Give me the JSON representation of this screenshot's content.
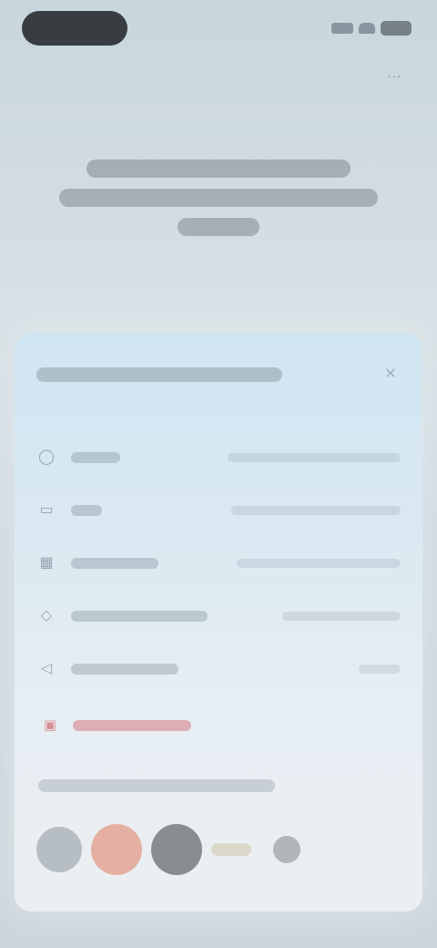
{
  "status_bar": {
    "icons": [
      "signal-icon",
      "wifi-icon",
      "battery-icon"
    ]
  },
  "top_icon": "more-icon",
  "sheet": {
    "close_icon": "close-icon",
    "fields": [
      {
        "icon": "person-icon"
      },
      {
        "icon": "mail-icon"
      },
      {
        "icon": "calendar-icon"
      },
      {
        "icon": "location-icon"
      },
      {
        "icon": "tag-icon"
      }
    ],
    "danger_icon": "trash-icon",
    "swatches": [
      {
        "color": "#a9b1b7"
      },
      {
        "color": "#e3a08c"
      },
      {
        "color": "#6f7478"
      },
      {
        "color": "#d7d2bf"
      },
      {
        "color": "#a3a7aa"
      }
    ]
  },
  "colors": {
    "background": "#cfd9e0",
    "sheet_top": "#d0e5f2",
    "danger": "#d5797d"
  }
}
